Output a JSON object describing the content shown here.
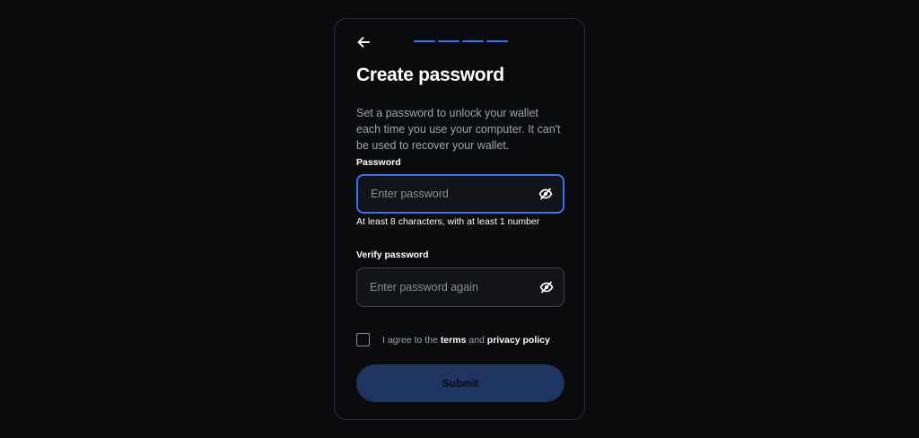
{
  "progress": {
    "total_steps": 4,
    "completed_steps": 4,
    "active_color": "#3773f5"
  },
  "header": {
    "back_icon": "arrow-left-icon",
    "title": "Create password",
    "description": "Set a password to unlock your wallet each time you use your computer. It can't be used to recover your wallet."
  },
  "password": {
    "label": "Password",
    "placeholder": "Enter password",
    "value": "",
    "visibility_icon": "eye-off-icon",
    "hint": "At least 8 characters, with at least 1 number"
  },
  "verify": {
    "label": "Verify password",
    "placeholder": "Enter password again",
    "value": "",
    "visibility_icon": "eye-off-icon"
  },
  "agreement": {
    "prefix": "I agree to the",
    "terms": "terms",
    "and": "and",
    "privacy": "privacy policy",
    "checked": false
  },
  "submit": {
    "label": "Submit"
  },
  "colors": {
    "background": "#0a0b0d",
    "accent": "#3773f5",
    "submit_disabled": "#1e3561"
  }
}
